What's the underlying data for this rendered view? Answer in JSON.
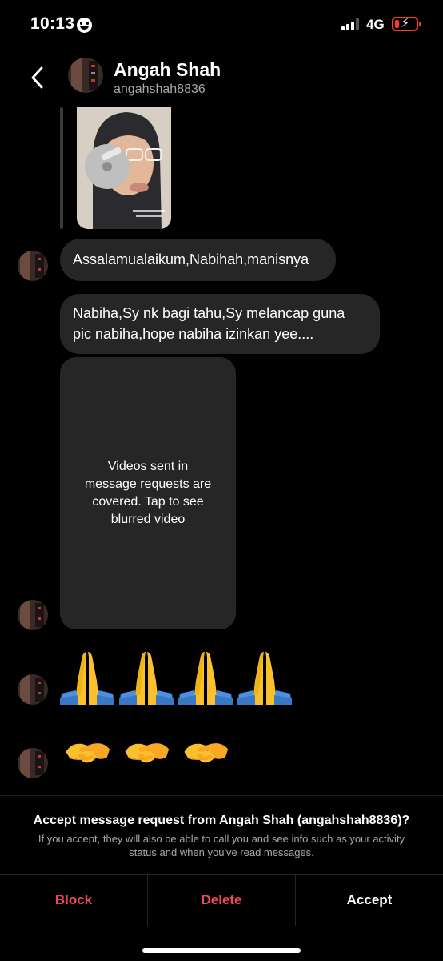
{
  "status_bar": {
    "time": "10:13",
    "network": "4G",
    "icons": [
      "smiley-face-icon",
      "signal-icon",
      "battery-charging-icon"
    ],
    "battery_level": 0.2,
    "battery_color": "#ff3b30"
  },
  "header": {
    "name": "Angah Shah",
    "username": "angahshah8836",
    "back_icon": "chevron-left-icon"
  },
  "messages": [
    {
      "type": "shared-photo"
    },
    {
      "type": "text",
      "text": "Assalamualaikum,Nabihah,manisnya"
    },
    {
      "type": "text",
      "text": "Nabiha,Sy nk bagi tahu,Sy melancap guna pic nabiha,hope nabiha izinkan yee...."
    },
    {
      "type": "video",
      "text": "Videos sent in message requests are covered. Tap to see blurred video"
    },
    {
      "type": "emoji",
      "emoji": "folded-hands",
      "count": 4
    },
    {
      "type": "emoji",
      "emoji": "handshake",
      "count": 3
    }
  ],
  "request": {
    "title": "Accept message request from Angah Shah (angahshah8836)?",
    "description": "If you accept, they will also be able to call you and see info such as your activity status and when you've read messages.",
    "block_label": "Block",
    "delete_label": "Delete",
    "accept_label": "Accept"
  },
  "colors": {
    "background": "#000000",
    "bubble": "#262626",
    "danger": "#ed4956",
    "secondary_text": "#a8a8a8"
  }
}
